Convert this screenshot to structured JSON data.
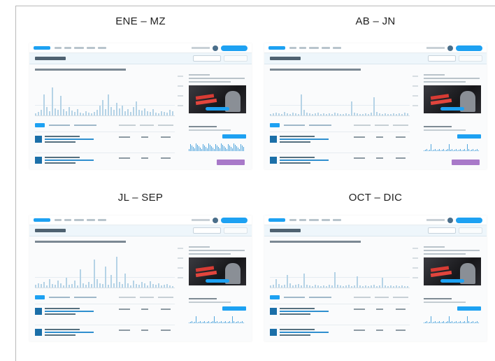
{
  "panels": [
    {
      "title": "ENE – MZ"
    },
    {
      "title": "AB – JN"
    },
    {
      "title": "JL – SEP"
    },
    {
      "title": "OCT – DIC"
    }
  ]
}
